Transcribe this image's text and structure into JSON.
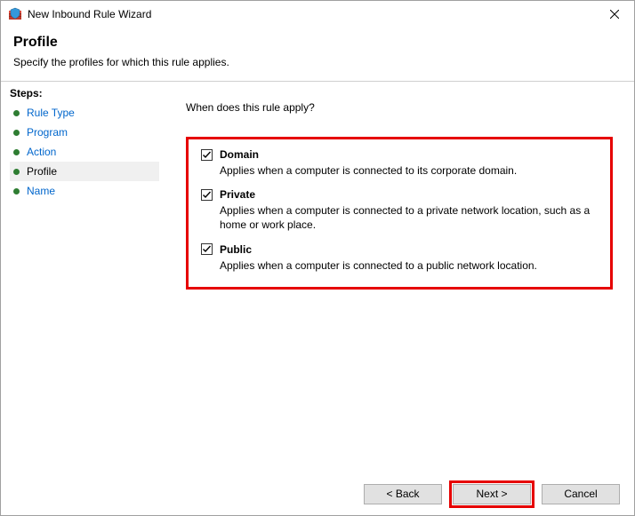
{
  "window": {
    "title": "New Inbound Rule Wizard"
  },
  "header": {
    "title": "Profile",
    "subtitle": "Specify the profiles for which this rule applies."
  },
  "sidebar": {
    "title": "Steps:",
    "items": [
      {
        "label": "Rule Type"
      },
      {
        "label": "Program"
      },
      {
        "label": "Action"
      },
      {
        "label": "Profile"
      },
      {
        "label": "Name"
      }
    ],
    "current_index": 3
  },
  "content": {
    "question": "When does this rule apply?",
    "profiles": [
      {
        "key": "domain",
        "label": "Domain",
        "checked": true,
        "description": "Applies when a computer is connected to its corporate domain."
      },
      {
        "key": "private",
        "label": "Private",
        "checked": true,
        "description": "Applies when a computer is connected to a private network location, such as a home or work place."
      },
      {
        "key": "public",
        "label": "Public",
        "checked": true,
        "description": "Applies when a computer is connected to a public network location."
      }
    ]
  },
  "footer": {
    "back": "< Back",
    "next": "Next >",
    "cancel": "Cancel"
  }
}
